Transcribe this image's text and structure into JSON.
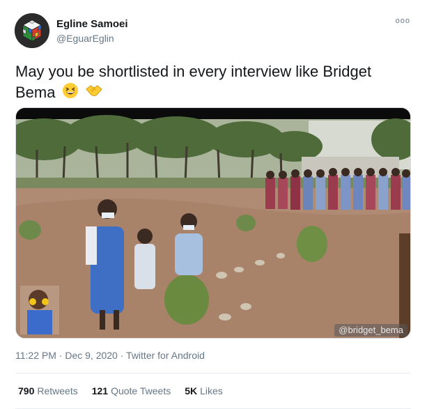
{
  "author": {
    "name": "Egline Samoei",
    "handle": "@EguarEglin",
    "avatar_icon": "rubiks-cube-icon"
  },
  "more_label": "ooo",
  "tweet_text": "May you be shortlisted in every interview like Bridget Bema",
  "emojis": [
    "grinning-squinting-face-icon",
    "handshake-icon"
  ],
  "media": {
    "watermark": "@bridget_bema"
  },
  "meta": {
    "time": "11:22 PM",
    "separator": "·",
    "date": "Dec 9, 2020",
    "source": "Twitter for Android"
  },
  "stats": {
    "retweets_count": "790",
    "retweets_label": "Retweets",
    "quotes_count": "121",
    "quotes_label": "Quote Tweets",
    "likes_count": "5K",
    "likes_label": "Likes"
  }
}
